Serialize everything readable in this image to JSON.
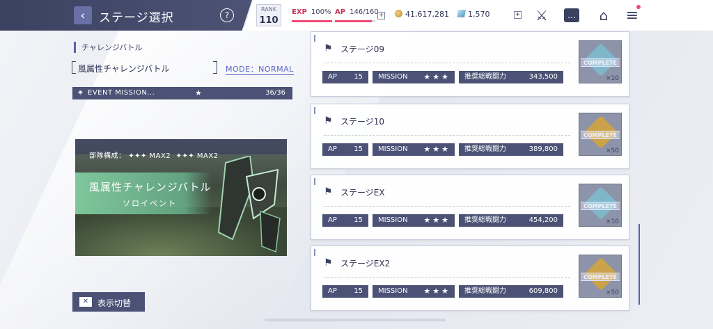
{
  "header": {
    "title": "ステージ選択",
    "help_label": "?",
    "rank_label": "RANK",
    "rank_value": "110",
    "exp_label": "EXP",
    "exp_value": "100%",
    "exp_fill": 1.0,
    "ap_label": "AP",
    "ap_value": "146/160",
    "ap_fill": 0.91,
    "plus": "+",
    "gold": "41,617,281",
    "gems": "1,570"
  },
  "icons": [
    "back-arrow-icon",
    "swords-icon",
    "chat-icon",
    "home-icon",
    "menu-icon"
  ],
  "left": {
    "section_label": "チャレンジバトル",
    "event_name": "風属性チャレンジバトル",
    "mode": "MODE：NORMAL",
    "mission_label": "EVENT MISSION...",
    "mission_count": "36/36",
    "banner": {
      "composition": "部隊構成：",
      "comp_a": "MAX2",
      "comp_b": "MAX2",
      "title": "風属性チャレンジバトル",
      "subtitle": "ソロイベント"
    },
    "toggle_label": "表示切替"
  },
  "stages": [
    {
      "name": "ステージ09",
      "ap_label": "AP",
      "ap": "15",
      "mission_label": "MISSION",
      "power_label": "推奨総戦闘力",
      "power": "343,500",
      "status": "COMPLETE",
      "qty": "×10",
      "medal": "blue"
    },
    {
      "name": "ステージ10",
      "ap_label": "AP",
      "ap": "15",
      "mission_label": "MISSION",
      "power_label": "推奨総戦闘力",
      "power": "389,800",
      "status": "COMPLETE",
      "qty": "×50",
      "medal": "gold"
    },
    {
      "name": "ステージEX",
      "ap_label": "AP",
      "ap": "15",
      "mission_label": "MISSION",
      "power_label": "推奨総戦闘力",
      "power": "454,200",
      "status": "COMPLETE",
      "qty": "×10",
      "medal": "blue"
    },
    {
      "name": "ステージEX2",
      "ap_label": "AP",
      "ap": "15",
      "mission_label": "MISSION",
      "power_label": "推奨総戦闘力",
      "power": "609,800",
      "status": "COMPLETE",
      "qty": "×50",
      "medal": "gold"
    }
  ],
  "colors": {
    "accent": "#4b5275",
    "pink": "#ec4b77",
    "link": "#5a63c8",
    "medal_blue": "#7fb6c9",
    "medal_gold": "#c9a24a"
  }
}
